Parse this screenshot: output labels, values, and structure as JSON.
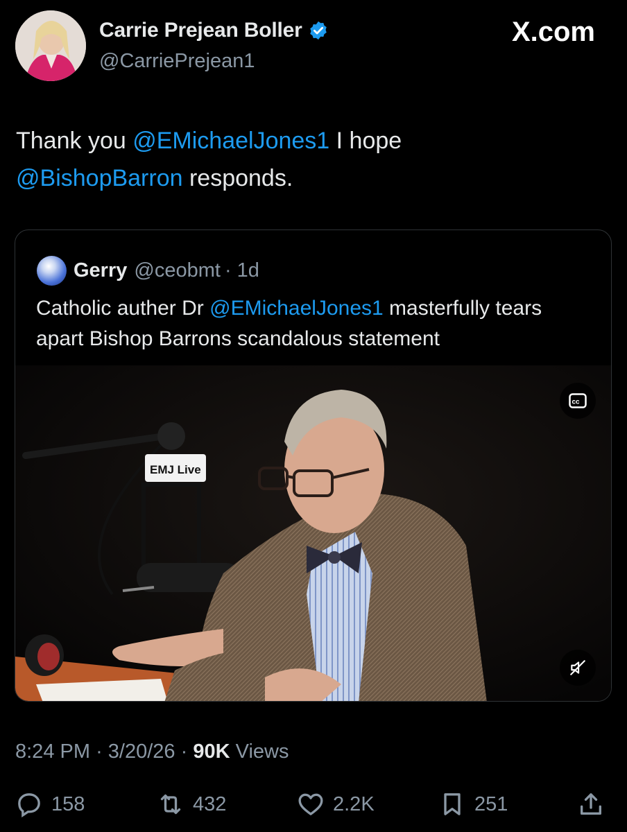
{
  "author": {
    "display_name": "Carrie Prejean Boller",
    "handle": "@CarriePrejean1",
    "verified_icon": "verified-badge-icon"
  },
  "source_label": "X.com",
  "tweet": {
    "text_part1": "Thank you ",
    "mention1": "@EMichaelJones1",
    "text_part2": " I hope ",
    "mention2": "@BishopBarron",
    "text_part3": " responds."
  },
  "quote": {
    "name": "Gerry",
    "handle": "@ceobmt",
    "time": "· 1d",
    "text_part1": "Catholic auther Dr ",
    "mention": "@EMichaelJones1",
    "text_part2": " masterfully tears apart Bishop Barrons scandalous statement",
    "video": {
      "overlay_sign": "EMJ Live",
      "cc_icon": "closed-captions-icon",
      "mute_icon": "muted-speaker-icon"
    }
  },
  "meta": {
    "time": "8:24 PM",
    "date": "3/20/26",
    "separator": "·",
    "views_count": "90K",
    "views_label": "Views"
  },
  "actions": {
    "replies": "158",
    "reposts": "432",
    "likes": "2.2K",
    "bookmarks": "251"
  },
  "colors": {
    "background": "#000000",
    "text": "#e7e9ea",
    "secondary": "#8b98a5",
    "mention": "#1d9bf0",
    "border": "#2f3336"
  }
}
